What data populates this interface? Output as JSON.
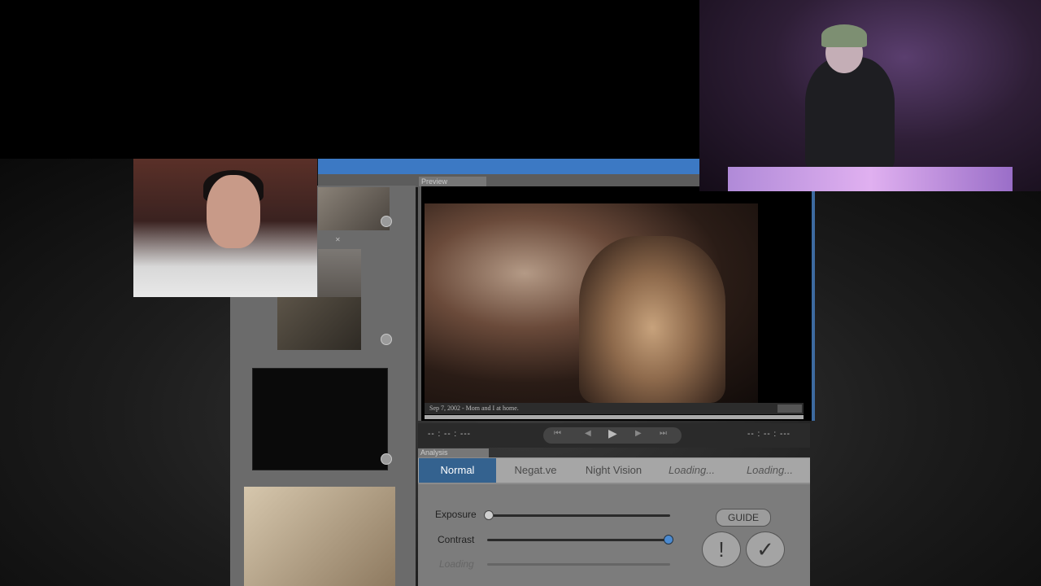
{
  "preview": {
    "tab_label": "Preview",
    "caption": "Sep 7, 2002 - Mom and I at home."
  },
  "transport": {
    "time_left": "-- : -- : ---",
    "time_right": "-- : -- : ---",
    "icons": [
      "skip-back-icon",
      "step-back-icon",
      "play-icon",
      "step-forward-icon",
      "skip-forward-icon"
    ]
  },
  "analysis": {
    "tab_label": "Analysis",
    "modes": [
      {
        "label": "Normal",
        "active": true
      },
      {
        "label": "Negat.ve",
        "active": false
      },
      {
        "label": "Night Vision",
        "active": false
      },
      {
        "label": "Loading...",
        "active": false
      },
      {
        "label": "Loading...",
        "active": false
      }
    ],
    "sliders": [
      {
        "label": "Exposure",
        "value": 0.0
      },
      {
        "label": "Contrast",
        "value": 1.0
      },
      {
        "label": "Loading",
        "value": 0.5
      }
    ],
    "guide_label": "GUIDE",
    "warn_symbol": "!",
    "confirm_symbol": "✓"
  },
  "colors": {
    "title_bar": "#3c79c4",
    "active_tab": "#34628f",
    "slider_knob_active": "#4b8ad0"
  }
}
